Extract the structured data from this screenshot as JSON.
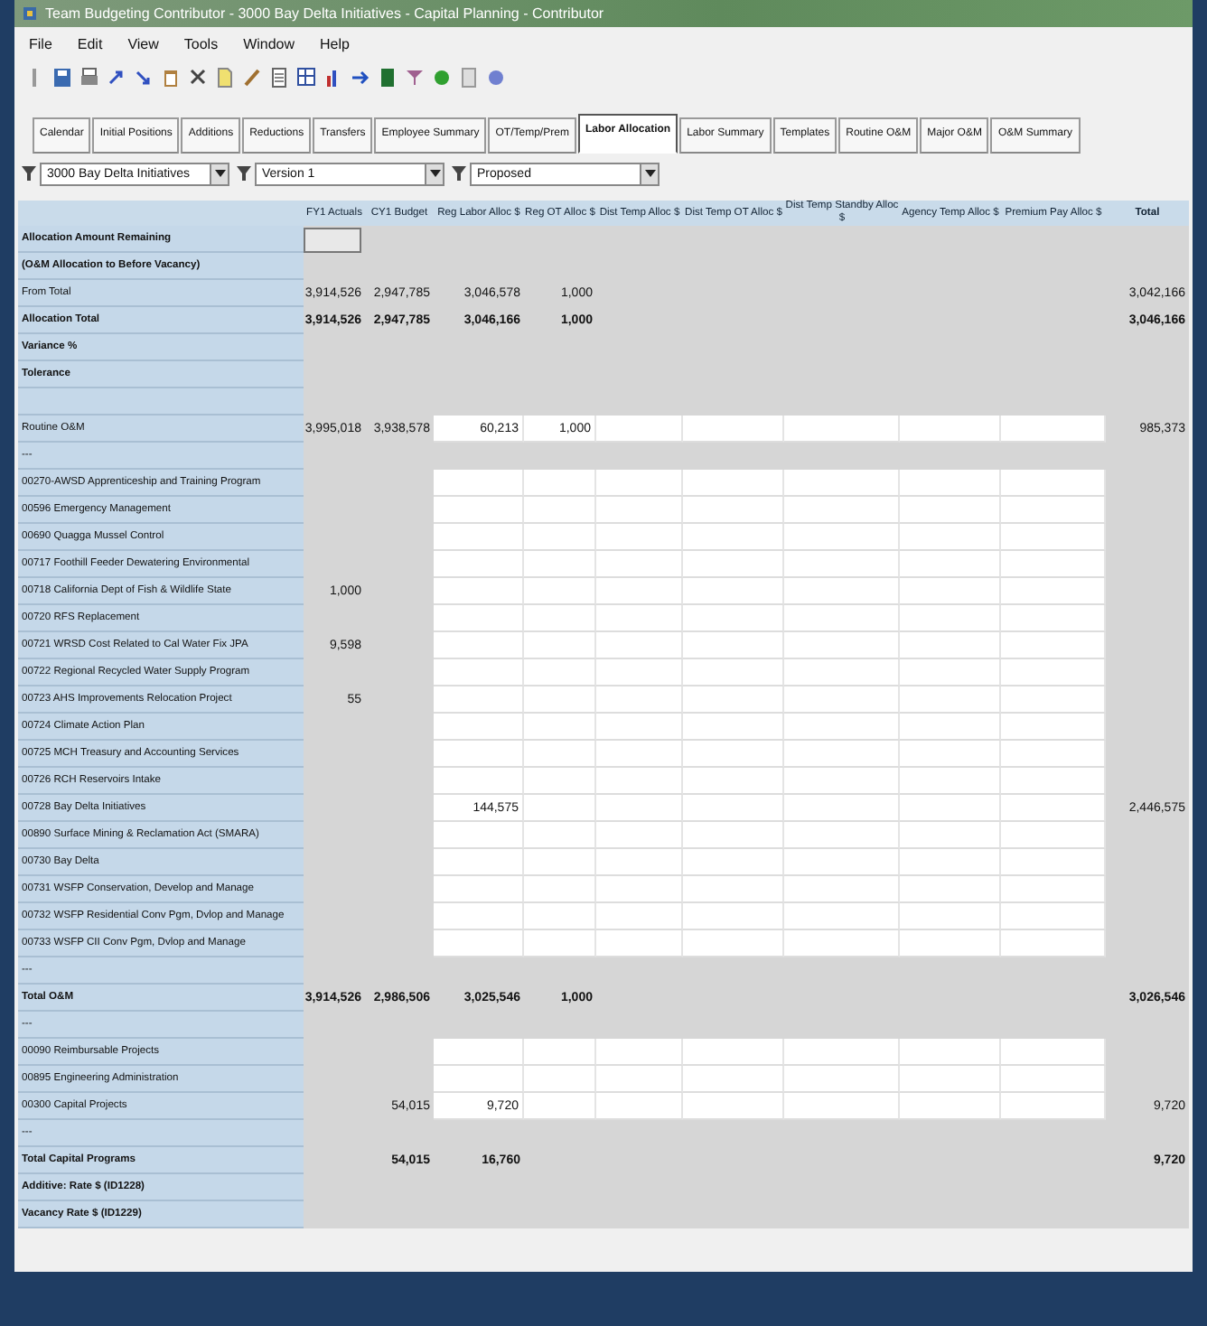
{
  "window": {
    "title": "Team Budgeting Contributor - 3000 Bay Delta Initiatives - Capital Planning - Contributor"
  },
  "menu": [
    "File",
    "Edit",
    "View",
    "Tools",
    "Window",
    "Help"
  ],
  "tabs": [
    {
      "label": "Calendar",
      "selected": false
    },
    {
      "label": "Initial Positions",
      "selected": false
    },
    {
      "label": "Additions",
      "selected": false
    },
    {
      "label": "Reductions",
      "selected": false
    },
    {
      "label": "Transfers",
      "selected": false
    },
    {
      "label": "Employee Summary",
      "selected": false
    },
    {
      "label": "OT/Temp/Prem",
      "selected": false
    },
    {
      "label": "Labor Allocation",
      "selected": true
    },
    {
      "label": "Labor Summary",
      "selected": false
    },
    {
      "label": "Templates",
      "selected": false
    },
    {
      "label": "Routine O&M",
      "selected": false
    },
    {
      "label": "Major O&M",
      "selected": false
    },
    {
      "label": "O&M Summary",
      "selected": false
    }
  ],
  "filters": [
    {
      "value": "3000 Bay Delta Initiatives"
    },
    {
      "value": "Version 1"
    },
    {
      "value": "Proposed"
    }
  ],
  "table": {
    "columns": [
      "FY1 Actuals",
      "CY1 Budget",
      "Reg Labor Alloc $",
      "Reg OT Alloc $",
      "Dist Temp Alloc $",
      "Dist Temp OT Alloc $",
      "Dist Temp Standby Alloc $",
      "Agency Temp Alloc $",
      "Premium Pay Alloc $",
      "Total"
    ],
    "rows": [
      {
        "label": "Allocation Amount Remaining",
        "bold": true,
        "kind": "remaining"
      },
      {
        "label": "(O&M Allocation to Before Vacancy)",
        "bold": true,
        "kind": "calc"
      },
      {
        "label": "From Total",
        "bold": false,
        "kind": "calc",
        "fy1_actuals": "3,914,526",
        "cy1_budget": "2,947,785",
        "reg_labor": "3,046,578",
        "reg_ot": "1,000",
        "total": "3,042,166"
      },
      {
        "label": "Allocation Total",
        "bold": true,
        "kind": "calc",
        "fy1_actuals": "3,914,526",
        "cy1_budget": "2,947,785",
        "reg_labor": "3,046,166",
        "reg_ot": "1,000",
        "total": "3,046,166"
      },
      {
        "label": "Variance %",
        "bold": true,
        "kind": "calc"
      },
      {
        "label": "Tolerance",
        "bold": true,
        "kind": "calc"
      },
      {
        "kind": "blank"
      },
      {
        "label": "Routine O&M",
        "bold": false,
        "kind": "input",
        "fy1_actuals": "3,995,018",
        "cy1_budget": "3,938,578",
        "reg_labor": "60,213",
        "reg_ot": "1,000",
        "total": "985,373"
      },
      {
        "label": "---",
        "bold": false,
        "kind": "calc"
      },
      {
        "label": "00270-AWSD Apprenticeship and Training Program",
        "bold": false,
        "kind": "input"
      },
      {
        "label": "00596 Emergency Management",
        "bold": false,
        "kind": "input"
      },
      {
        "label": "00690 Quagga Mussel Control",
        "bold": false,
        "kind": "input"
      },
      {
        "label": "00717 Foothill Feeder Dewatering Environmental",
        "bold": false,
        "kind": "input"
      },
      {
        "label": "00718 California Dept of Fish & Wildlife State",
        "bold": false,
        "kind": "input",
        "fy1_actuals": "1,000"
      },
      {
        "label": "00720 RFS Replacement",
        "bold": false,
        "kind": "input"
      },
      {
        "label": "00721 WRSD Cost Related to Cal Water Fix JPA",
        "bold": false,
        "kind": "input",
        "fy1_actuals": "9,598"
      },
      {
        "label": "00722 Regional Recycled Water Supply Program",
        "bold": false,
        "kind": "input"
      },
      {
        "label": "00723 AHS Improvements Relocation Project",
        "bold": false,
        "kind": "input",
        "fy1_actuals": "55"
      },
      {
        "label": "00724 Climate Action Plan",
        "bold": false,
        "kind": "input"
      },
      {
        "label": "00725 MCH Treasury and Accounting Services",
        "bold": false,
        "kind": "input"
      },
      {
        "label": "00726 RCH Reservoirs Intake",
        "bold": false,
        "kind": "input"
      },
      {
        "label": "00728 Bay Delta Initiatives",
        "bold": false,
        "kind": "input",
        "reg_labor": "144,575",
        "total": "2,446,575"
      },
      {
        "label": "00890 Surface Mining & Reclamation Act (SMARA)",
        "bold": false,
        "kind": "input"
      },
      {
        "label": "00730 Bay Delta",
        "bold": false,
        "kind": "input"
      },
      {
        "label": "00731 WSFP Conservation, Develop and Manage",
        "bold": false,
        "kind": "input"
      },
      {
        "label": "00732 WSFP Residential Conv Pgm, Dvlop and Manage",
        "bold": false,
        "kind": "input"
      },
      {
        "label": "00733 WSFP CII Conv Pgm, Dvlop and Manage",
        "bold": false,
        "kind": "input"
      },
      {
        "label": "---",
        "bold": false,
        "kind": "calc"
      },
      {
        "label": "Total O&M",
        "bold": true,
        "kind": "calc",
        "fy1_actuals": "3,914,526",
        "cy1_budget": "2,986,506",
        "reg_labor": "3,025,546",
        "reg_ot": "1,000",
        "total": "3,026,546"
      },
      {
        "label": "---",
        "bold": false,
        "kind": "calc"
      },
      {
        "label": "00090 Reimbursable Projects",
        "bold": false,
        "kind": "input"
      },
      {
        "label": "00895 Engineering Administration",
        "bold": false,
        "kind": "input"
      },
      {
        "label": "00300 Capital Projects",
        "bold": false,
        "kind": "input",
        "cy1_budget": "54,015",
        "reg_labor": "9,720",
        "total": "9,720"
      },
      {
        "label": "---",
        "bold": false,
        "kind": "calc"
      },
      {
        "label": "Total Capital Programs",
        "bold": true,
        "kind": "calc",
        "cy1_budget": "54,015",
        "reg_labor": "16,760",
        "total": "9,720"
      },
      {
        "label": "Additive: Rate $ (ID1228)",
        "bold": true,
        "kind": "calc"
      },
      {
        "label": "Vacancy Rate $ (ID1229)",
        "bold": true,
        "kind": "calc"
      }
    ]
  }
}
